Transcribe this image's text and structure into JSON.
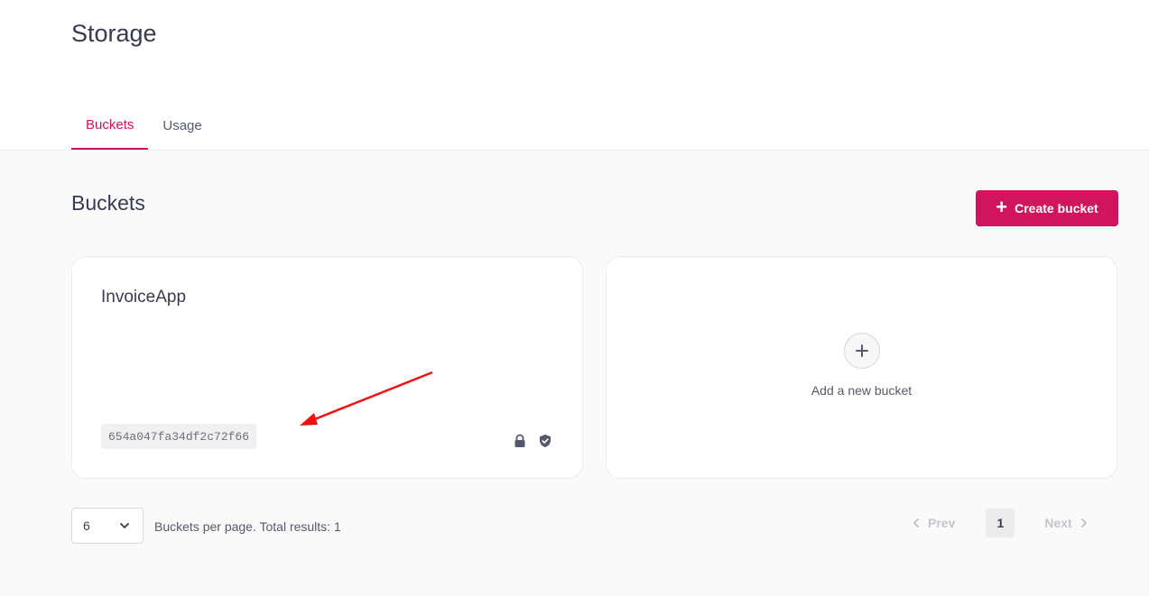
{
  "page": {
    "title": "Storage"
  },
  "tabs": [
    {
      "label": "Buckets",
      "active": true
    },
    {
      "label": "Usage",
      "active": false
    }
  ],
  "section": {
    "title": "Buckets",
    "create_button_label": "Create bucket"
  },
  "buckets": [
    {
      "name": "InvoiceApp",
      "id": "654a047fa34df2c72f66",
      "icons": [
        "lock-icon",
        "shield-check-icon"
      ]
    }
  ],
  "add_card": {
    "label": "Add a new bucket"
  },
  "pagination": {
    "per_page_value": "6",
    "summary": "Buckets per page. Total results: 1",
    "prev_label": "Prev",
    "next_label": "Next",
    "current_page": "1"
  },
  "colors": {
    "accent": "#d0155d",
    "annotation_arrow": "#ee1111"
  }
}
